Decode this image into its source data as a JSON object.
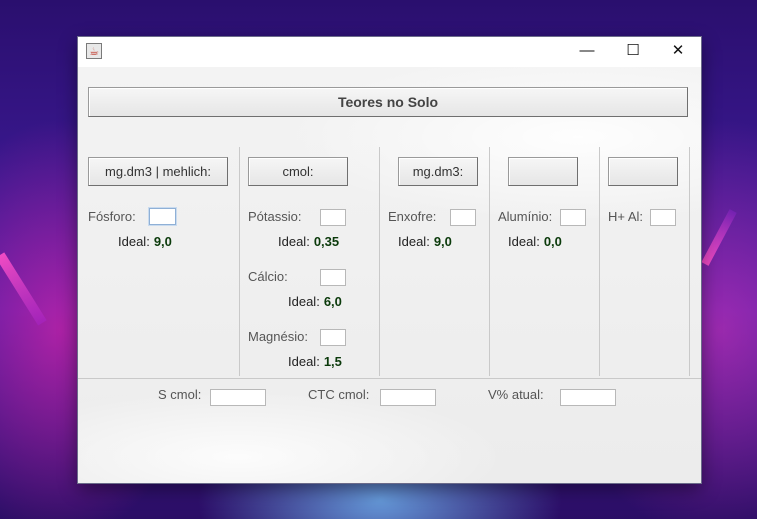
{
  "window": {
    "controls": {
      "minimize": "—",
      "maximize": "☐",
      "close": "✕"
    },
    "app_icon": "java-cup-icon"
  },
  "header_button": "Teores no Solo",
  "columns": {
    "col1_button": "mg.dm3 | mehlich:",
    "col2_button": "cmol:",
    "col3_button": "mg.dm3:",
    "col4_button": "",
    "col5_button": ""
  },
  "nutrients": {
    "fosforo": {
      "label": "Fósforo:",
      "ideal_label": "Ideal:",
      "ideal_value": "9,0",
      "value": ""
    },
    "potassio": {
      "label": "Pótassio:",
      "ideal_label": "Ideal:",
      "ideal_value": "0,35",
      "value": ""
    },
    "calcio": {
      "label": "Cálcio:",
      "ideal_label": "Ideal:",
      "ideal_value": "6,0",
      "value": ""
    },
    "magnesio": {
      "label": "Magnésio:",
      "ideal_label": "Ideal:",
      "ideal_value": "1,5",
      "value": ""
    },
    "enxofre": {
      "label": "Enxofre:",
      "ideal_label": "Ideal:",
      "ideal_value": "9,0",
      "value": ""
    },
    "aluminio": {
      "label": "Alumínio:",
      "ideal_label": "Ideal:",
      "ideal_value": "0,0",
      "value": ""
    },
    "h_al": {
      "label": "H+ Al:",
      "value": ""
    }
  },
  "footer": {
    "s_cmol": {
      "label": "S cmol:",
      "value": ""
    },
    "ctc_cmol": {
      "label": "CTC cmol:",
      "value": ""
    },
    "v_atual": {
      "label": "V% atual:",
      "value": ""
    }
  }
}
